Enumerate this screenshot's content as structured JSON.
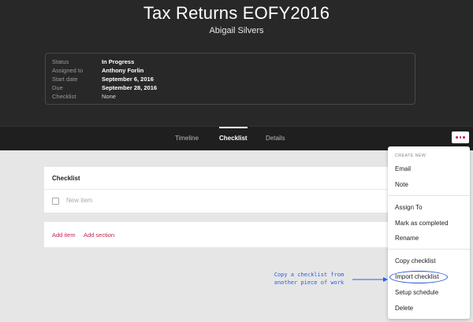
{
  "header": {
    "title": "Tax Returns EOFY2016",
    "subtitle": "Abigail Silvers"
  },
  "details": {
    "rows": [
      {
        "label": "Status",
        "value": "In Progress"
      },
      {
        "label": "Assigned to",
        "value": "Anthony Forlin"
      },
      {
        "label": "Start date",
        "value": "September 6, 2016"
      },
      {
        "label": "Due",
        "value": "September 28, 2016"
      },
      {
        "label": "Checklist",
        "value": "None"
      }
    ]
  },
  "tabs": [
    {
      "label": "Timeline"
    },
    {
      "label": "Checklist",
      "active": true
    },
    {
      "label": "Details"
    }
  ],
  "more_button": {
    "icon": "more-dots-icon",
    "color": "#d11f4d"
  },
  "checklist_card": {
    "title": "Checklist",
    "new_item_placeholder": "New item"
  },
  "actions": {
    "add_item": "Add item",
    "add_section": "Add section",
    "link_color": "#c8234f"
  },
  "menu": {
    "section_header": "CREATE NEW",
    "items": [
      {
        "label": "Email"
      },
      {
        "label": "Note"
      },
      {
        "label": "Assign To"
      },
      {
        "label": "Mark as completed"
      },
      {
        "label": "Rename"
      },
      {
        "label": "Copy checklist"
      },
      {
        "label": "Import checklist"
      },
      {
        "label": "Setup schedule"
      },
      {
        "label": "Delete"
      }
    ]
  },
  "annotation": {
    "line1": "Copy a checklist from",
    "line2": "another piece of work",
    "color": "#2962e0"
  }
}
